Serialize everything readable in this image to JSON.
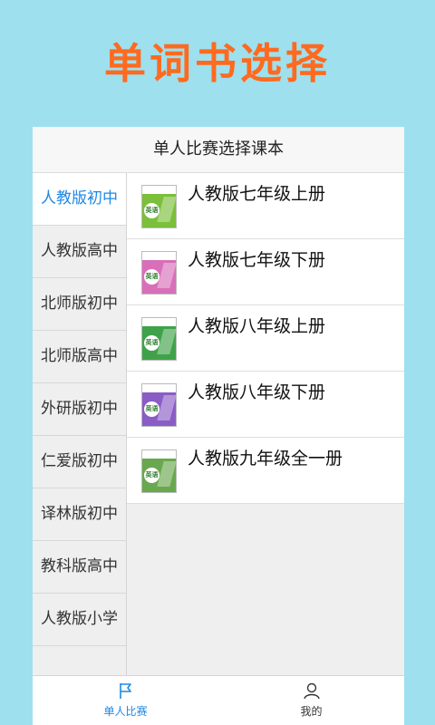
{
  "banner": {
    "title": "单词书选择"
  },
  "card": {
    "header": "单人比赛选择课本"
  },
  "sidebar": {
    "items": [
      {
        "label": "人教版初中",
        "active": true
      },
      {
        "label": "人教版高中"
      },
      {
        "label": "北师版初中"
      },
      {
        "label": "北师版高中"
      },
      {
        "label": "外研版初中"
      },
      {
        "label": "仁爱版初中"
      },
      {
        "label": "译林版初中"
      },
      {
        "label": "教科版高中"
      },
      {
        "label": "人教版小学"
      }
    ]
  },
  "books": [
    {
      "title": "人教版七年级上册",
      "cover_icon": "textbook-cover-icon",
      "cover_color": "#7bbf3a",
      "cover_label": "英语"
    },
    {
      "title": "人教版七年级下册",
      "cover_icon": "textbook-cover-icon",
      "cover_color": "#d86fb8",
      "cover_label": "英语"
    },
    {
      "title": "人教版八年级上册",
      "cover_icon": "textbook-cover-icon",
      "cover_color": "#3fa24a",
      "cover_label": "英语"
    },
    {
      "title": "人教版八年级下册",
      "cover_icon": "textbook-cover-icon",
      "cover_color": "#8a5cc6",
      "cover_label": "英语"
    },
    {
      "title": "人教版九年级全一册",
      "cover_icon": "textbook-cover-icon",
      "cover_color": "#6aa84f",
      "cover_label": "英语"
    }
  ],
  "tabbar": {
    "tabs": [
      {
        "label": "单人比赛",
        "icon": "flag-icon",
        "active": true
      },
      {
        "label": "我的",
        "icon": "user-icon"
      }
    ]
  },
  "colors": {
    "accent": "#1e88e5",
    "banner": "#ff6a1f",
    "background": "#9ee0ee"
  }
}
